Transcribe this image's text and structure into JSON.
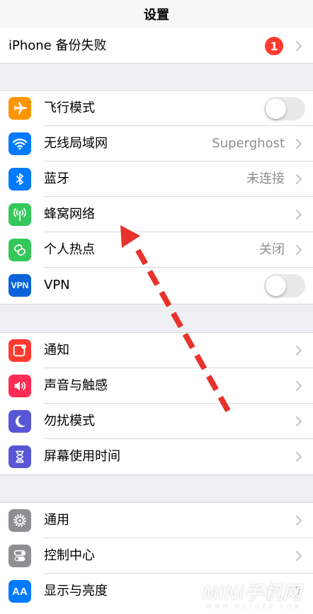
{
  "nav": {
    "title": "设置"
  },
  "backup": {
    "label": "iPhone 备份失败",
    "badge": "1"
  },
  "connectivity": [
    {
      "label": "飞行模式",
      "icon": "airplane-icon",
      "color": "#ff9500",
      "value": "",
      "toggle": false
    },
    {
      "label": "无线局域网",
      "icon": "wifi-icon",
      "color": "#007aff",
      "value": "Superghost"
    },
    {
      "label": "蓝牙",
      "icon": "bluetooth-icon",
      "color": "#007aff",
      "value": "未连接"
    },
    {
      "label": "蜂窝网络",
      "icon": "cellular-antenna-icon",
      "color": "#34c759",
      "value": ""
    },
    {
      "label": "个人热点",
      "icon": "hotspot-chain-icon",
      "color": "#34c759",
      "value": "关闭"
    },
    {
      "label": "VPN",
      "icon": "vpn-icon",
      "icon_text": "VPN",
      "color": "#0a64d8",
      "value": "",
      "toggle": false
    }
  ],
  "notifications": [
    {
      "label": "通知",
      "icon": "notifications-icon",
      "color": "#ff3b30"
    },
    {
      "label": "声音与触感",
      "icon": "speaker-icon",
      "color": "#ff2d55"
    },
    {
      "label": "勿扰模式",
      "icon": "moon-icon",
      "color": "#5856d6"
    },
    {
      "label": "屏幕使用时间",
      "icon": "hourglass-icon",
      "color": "#5856d6"
    }
  ],
  "general": [
    {
      "label": "通用",
      "icon": "gear-icon",
      "color": "#8e8e93"
    },
    {
      "label": "控制中心",
      "icon": "switches-icon",
      "color": "#8e8e93"
    },
    {
      "label": "显示与亮度",
      "icon": "display-aa-icon",
      "icon_text": "AA",
      "color": "#007aff"
    }
  ],
  "watermark": {
    "main": "MiNi手机网",
    "sub": "WWW.NETDED.COM"
  },
  "annotation": {
    "arrow_color": "#e8322b"
  }
}
